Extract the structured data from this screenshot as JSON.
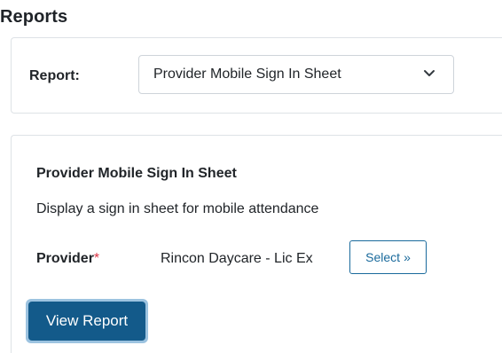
{
  "page": {
    "title": "Reports"
  },
  "selector": {
    "label": "Report:",
    "selected_value": "Provider Mobile Sign In Sheet"
  },
  "report": {
    "title": "Provider Mobile Sign In Sheet",
    "description": "Display a sign in sheet for mobile attendance",
    "provider_label": "Provider",
    "required_marker": "*",
    "provider_value": "Rincon Daycare - Lic Ex",
    "select_button_label": "Select",
    "select_button_icon": "»",
    "view_button_label": "View Report"
  },
  "colors": {
    "primary": "#135a8a",
    "primary_outline": "#1a6a9c",
    "required": "#dc3545",
    "focus_ring": "#9cc3e0"
  }
}
